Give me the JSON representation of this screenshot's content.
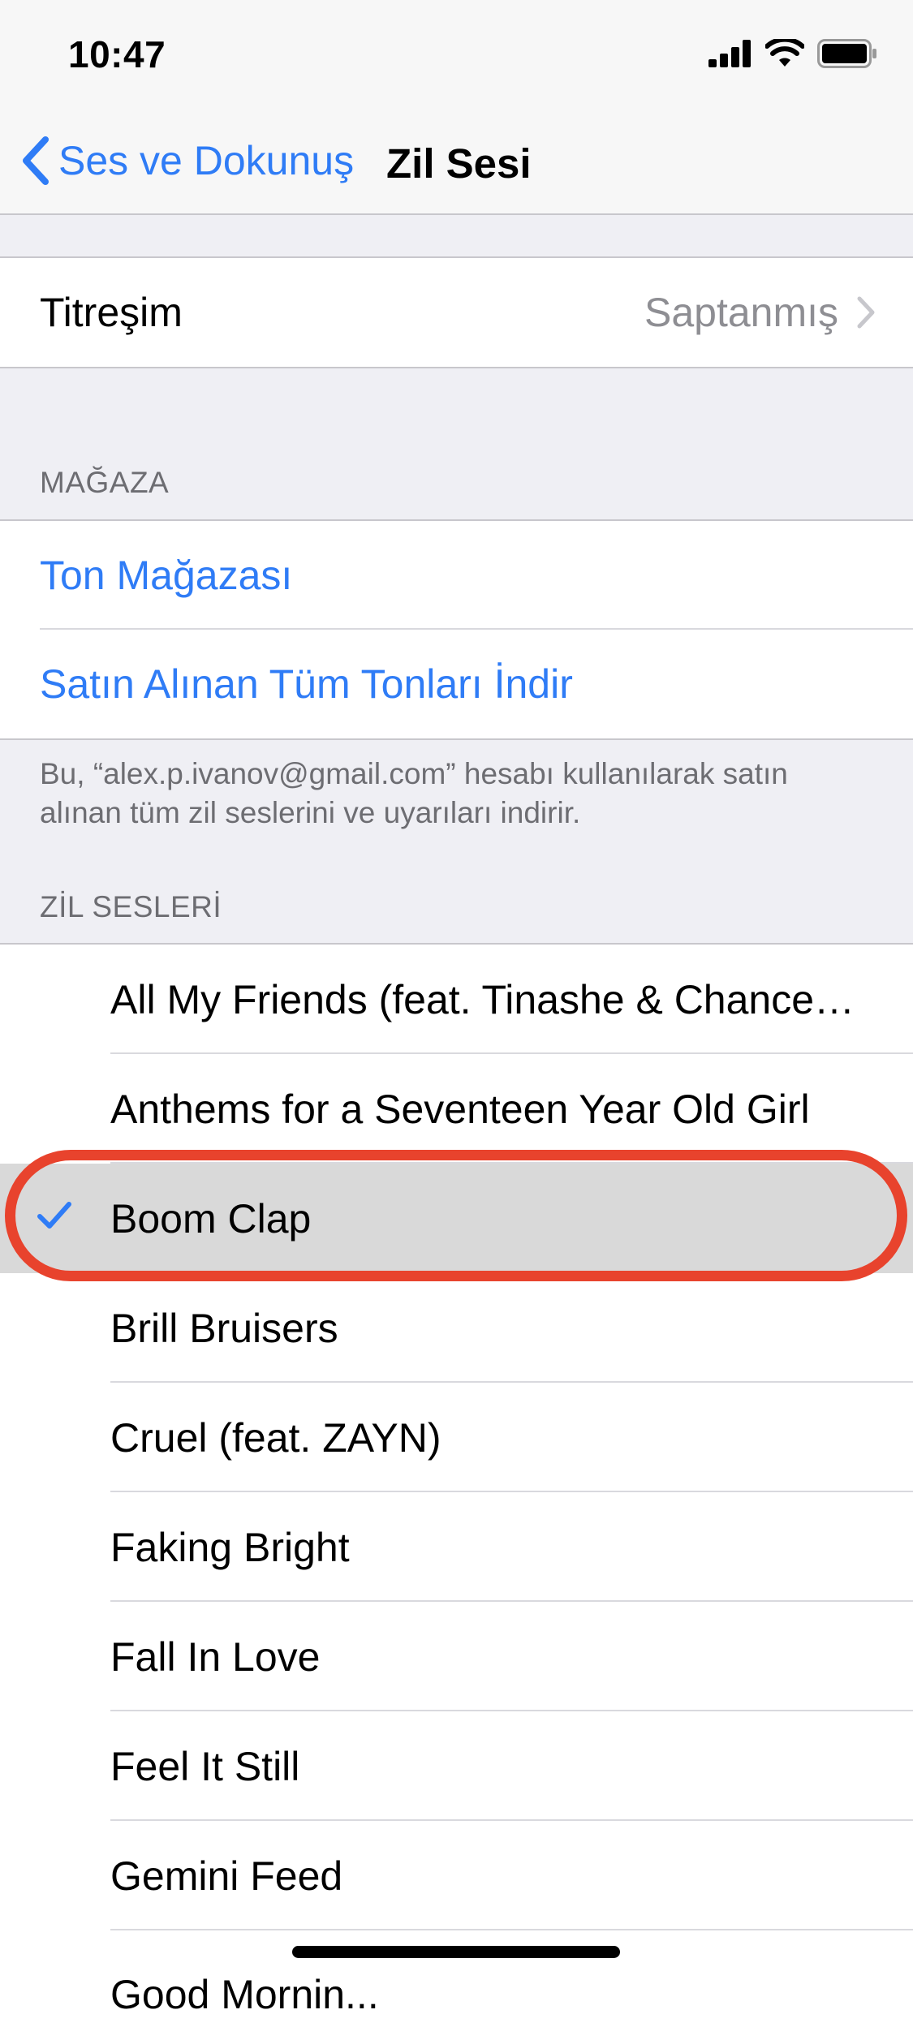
{
  "status_bar": {
    "time": "10:47"
  },
  "nav": {
    "back_label": "Ses ve Dokunuş",
    "title": "Zil Sesi"
  },
  "vibration": {
    "label": "Titreşim",
    "value": "Saptanmış"
  },
  "store": {
    "header": "MAĞAZA",
    "items": [
      "Ton Mağazası",
      "Satın Alınan Tüm Tonları İndir"
    ],
    "footer": "Bu, “alex.p.ivanov@gmail.com” hesabı kullanılarak satın alınan tüm zil seslerini ve uyarıları indirir."
  },
  "ringtones": {
    "header": "ZİL SESLERİ",
    "items": [
      "All My Friends (feat. Tinashe & Chance…",
      "Anthems for a Seventeen Year Old Girl",
      "Boom Clap",
      "Brill Bruisers",
      "Cruel (feat. ZAYN)",
      "Faking Bright",
      "Fall In Love",
      "Feel It Still",
      "Gemini Feed",
      "Good Mornin..."
    ],
    "selected_index": 2
  },
  "colors": {
    "accent": "#2f7cf6",
    "highlight": "#e8432d"
  },
  "icons": [
    "signal-icon",
    "wifi-icon",
    "battery-icon",
    "back-chevron-icon",
    "disclosure-chevron-icon",
    "checkmark-icon"
  ]
}
